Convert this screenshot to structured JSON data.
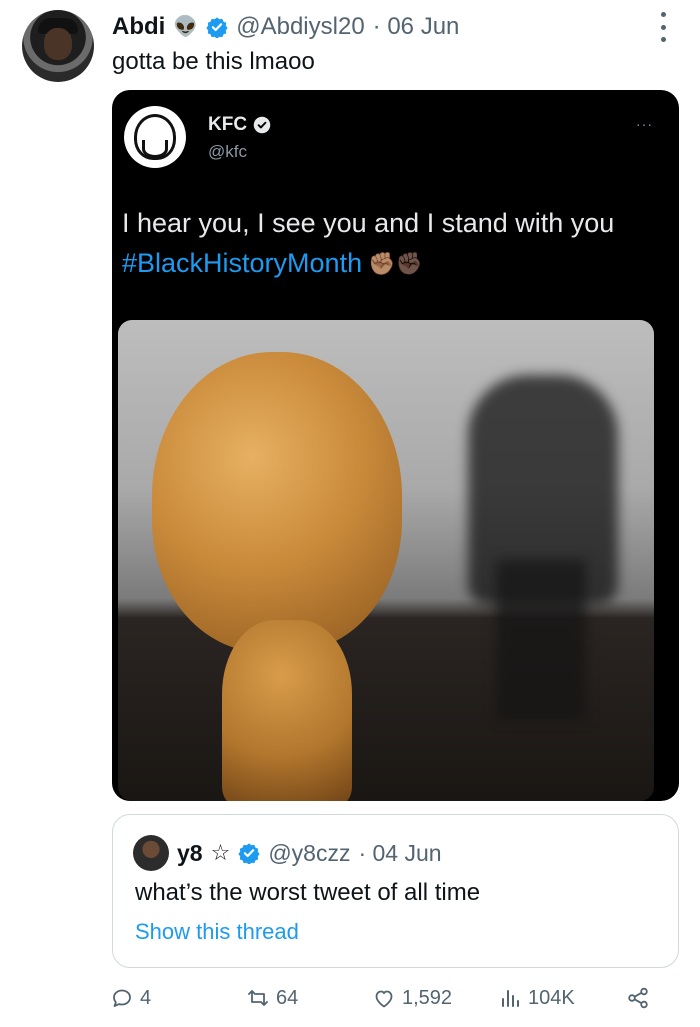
{
  "tweet": {
    "author_name": "Abdi",
    "author_emoji": "👽",
    "author_handle": "@Abdiysl20",
    "timestamp": "· 06 Jun",
    "text": "gotta be this lmaoo"
  },
  "embedded_screenshot": {
    "account_name": "KFC",
    "account_handle": "@kfc",
    "more_label": "···",
    "line1": "I hear you, I see you and I stand with you",
    "hashtag": "#BlackHistoryMonth",
    "hashtag_emoji": "✊🏽✊🏿"
  },
  "quoted_tweet": {
    "author_name": "y8",
    "author_symbol": "☆",
    "author_handle": "@y8czz",
    "timestamp": "· 04 Jun",
    "text": "what’s the worst tweet of all time",
    "link_label": "Show this thread"
  },
  "actions": {
    "replies": "4",
    "reposts": "64",
    "likes": "1,592",
    "views": "104K"
  },
  "colors": {
    "accent": "#1d9bf0",
    "text_secondary": "#536471",
    "border": "#cfd9de"
  },
  "icons": [
    "verified-badge-icon",
    "more-options-icon",
    "reply-icon",
    "repost-icon",
    "like-icon",
    "views-icon",
    "share-icon"
  ]
}
